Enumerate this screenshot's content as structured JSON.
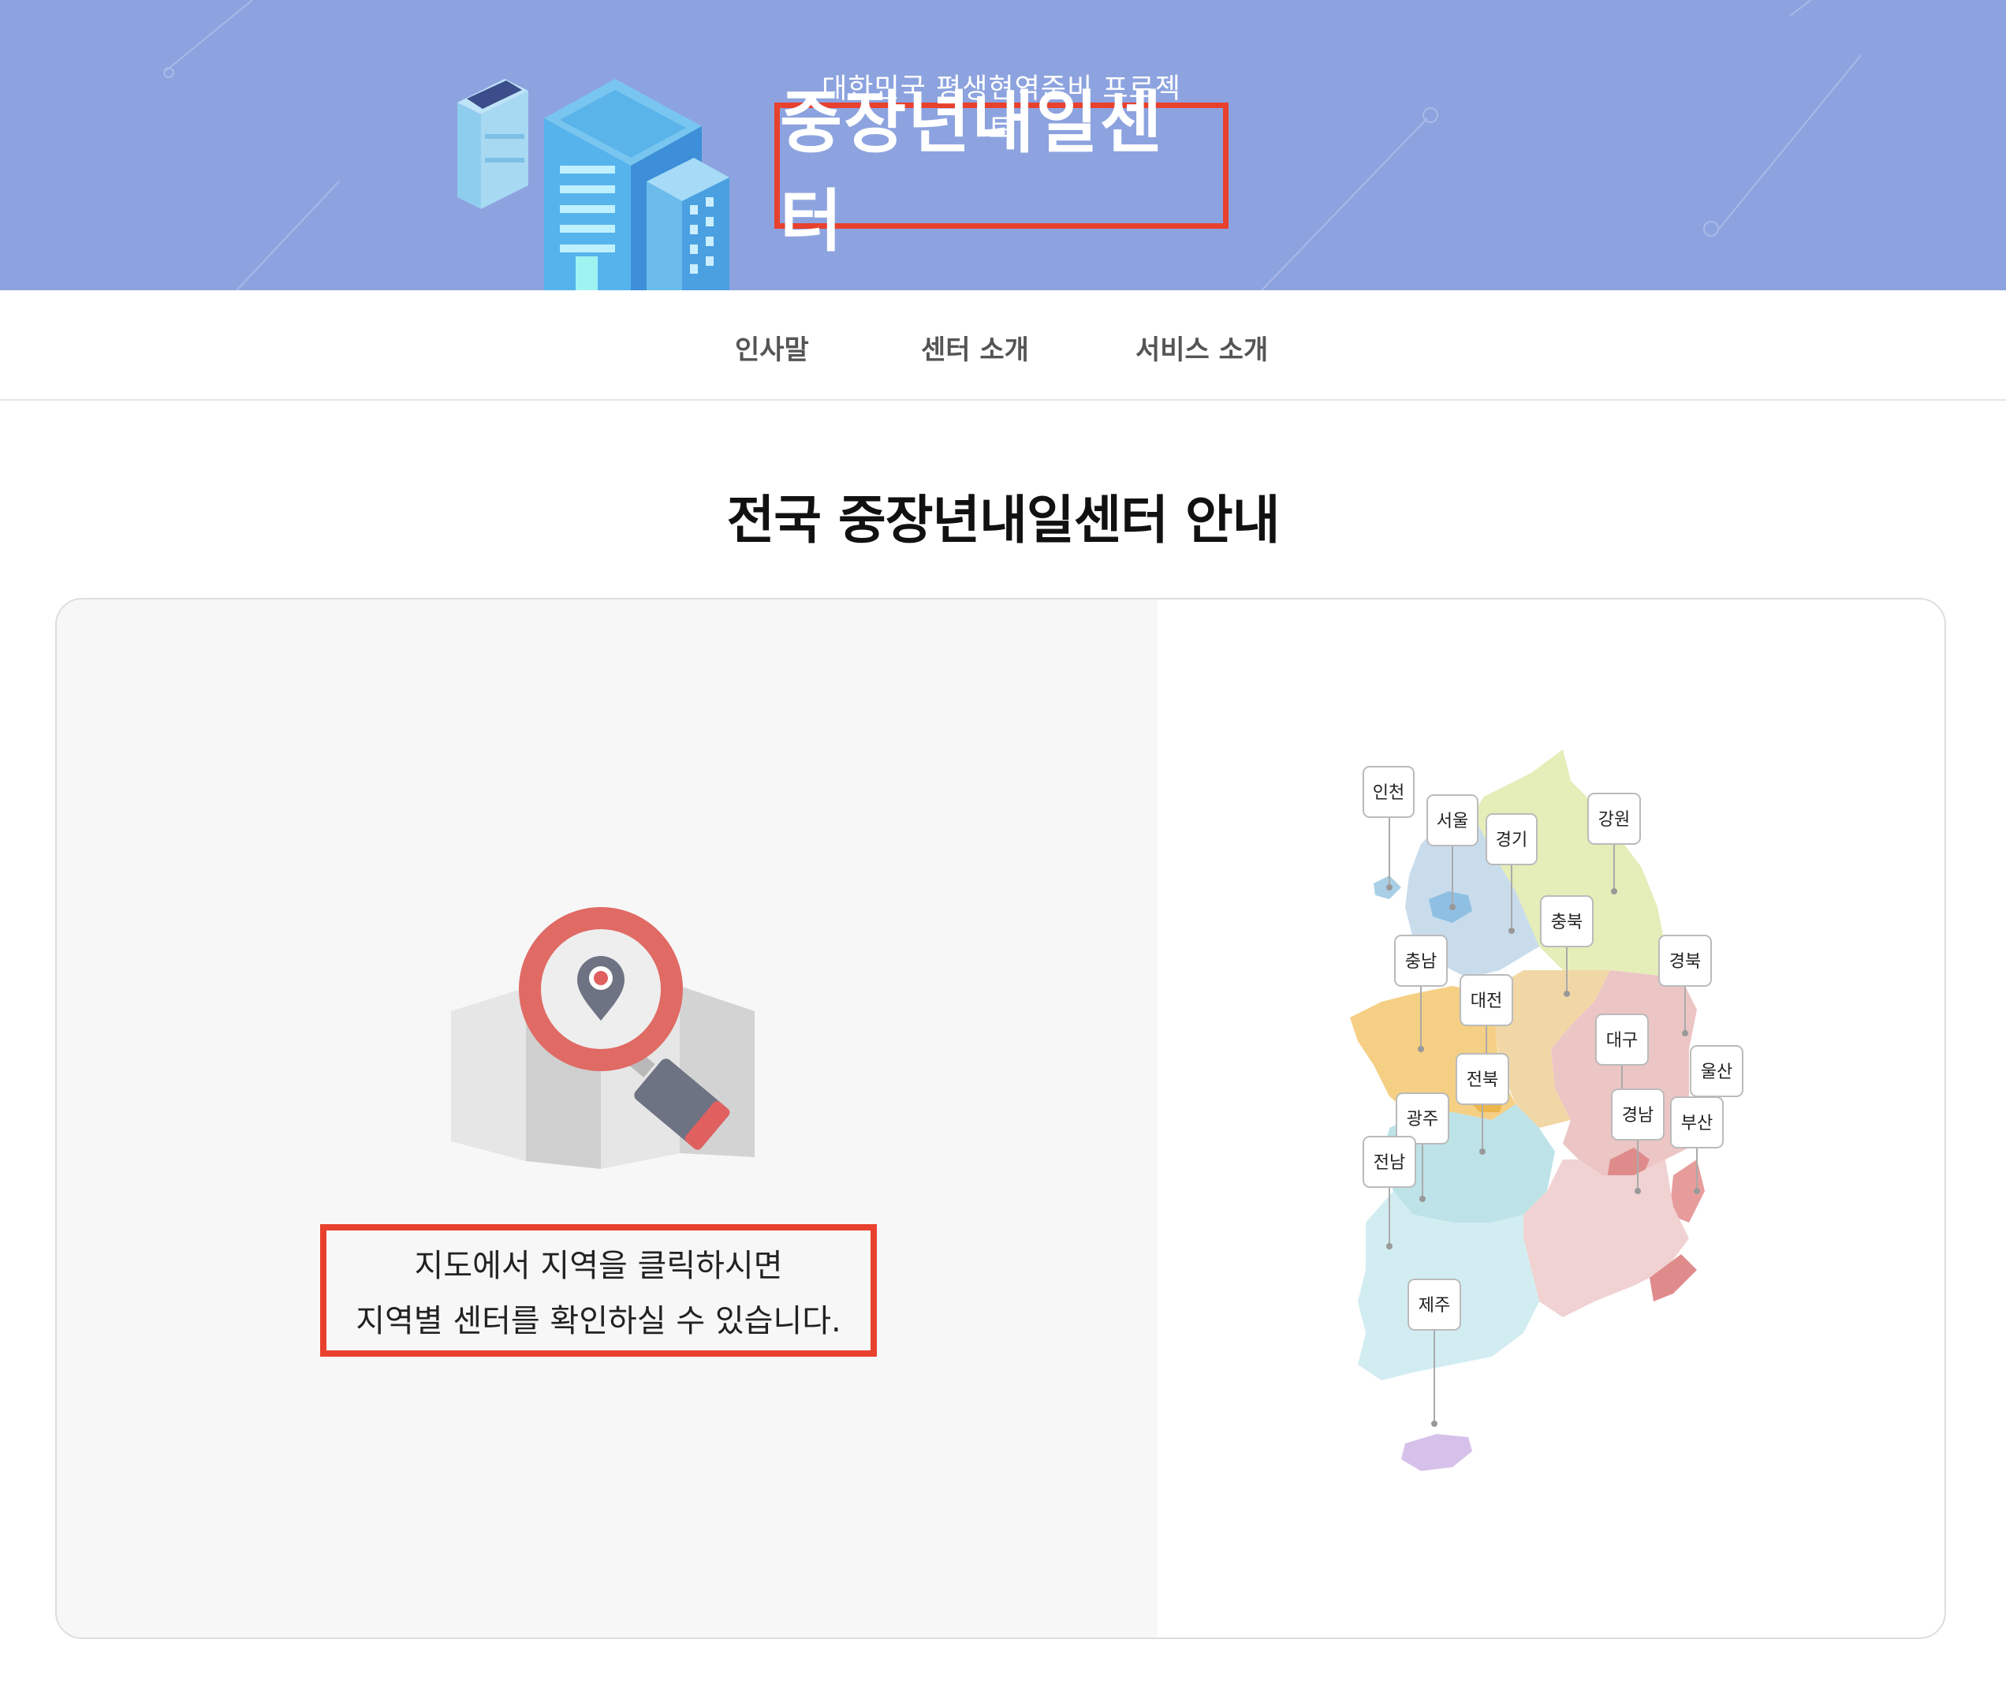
{
  "header": {
    "subtitle": "대한민국 평생현역준비 프로젝트",
    "title": "중장년내일센터",
    "bg_color": "#8da3df",
    "highlight_color": "#e8412d"
  },
  "nav": {
    "items": [
      {
        "label": "인사말"
      },
      {
        "label": "센터 소개"
      },
      {
        "label": "서비스 소개"
      }
    ]
  },
  "main": {
    "section_title": "전국 중장년내일센터 안내",
    "guide_text": {
      "line1": "지도에서 지역을 클릭하시면",
      "line2": "지역별 센터를 확인하실 수 있습니다."
    },
    "icons": {
      "map_search": "map-search-icon",
      "building": "building-illustration"
    }
  },
  "regions": [
    {
      "id": "incheon",
      "label": "인천",
      "color": "#a9cfe6"
    },
    {
      "id": "seoul",
      "label": "서울",
      "color": "#8fc0e3"
    },
    {
      "id": "gyeonggi",
      "label": "경기",
      "color": "#c9dcec"
    },
    {
      "id": "gangwon",
      "label": "강원",
      "color": "#e5edb9"
    },
    {
      "id": "chungbuk",
      "label": "충북",
      "color": "#f2d7a6"
    },
    {
      "id": "chungnam",
      "label": "충남",
      "color": "#f5cf84"
    },
    {
      "id": "daejeon",
      "label": "대전",
      "color": "#ecb64c"
    },
    {
      "id": "gyeongbuk",
      "label": "경북",
      "color": "#ecc5c5"
    },
    {
      "id": "daegu",
      "label": "대구",
      "color": "#e08b8b"
    },
    {
      "id": "ulsan",
      "label": "울산",
      "color": "#e79c9c"
    },
    {
      "id": "jeonbuk",
      "label": "전북",
      "color": "#bde3e8"
    },
    {
      "id": "gwangju",
      "label": "광주",
      "color": "#8ecbe0"
    },
    {
      "id": "gyeongnam",
      "label": "경남",
      "color": "#f1d2d2"
    },
    {
      "id": "busan",
      "label": "부산",
      "color": "#e08b8b"
    },
    {
      "id": "jeonnam",
      "label": "전남",
      "color": "#d2edf1"
    },
    {
      "id": "jeju",
      "label": "제주",
      "color": "#d6c1ea"
    }
  ]
}
